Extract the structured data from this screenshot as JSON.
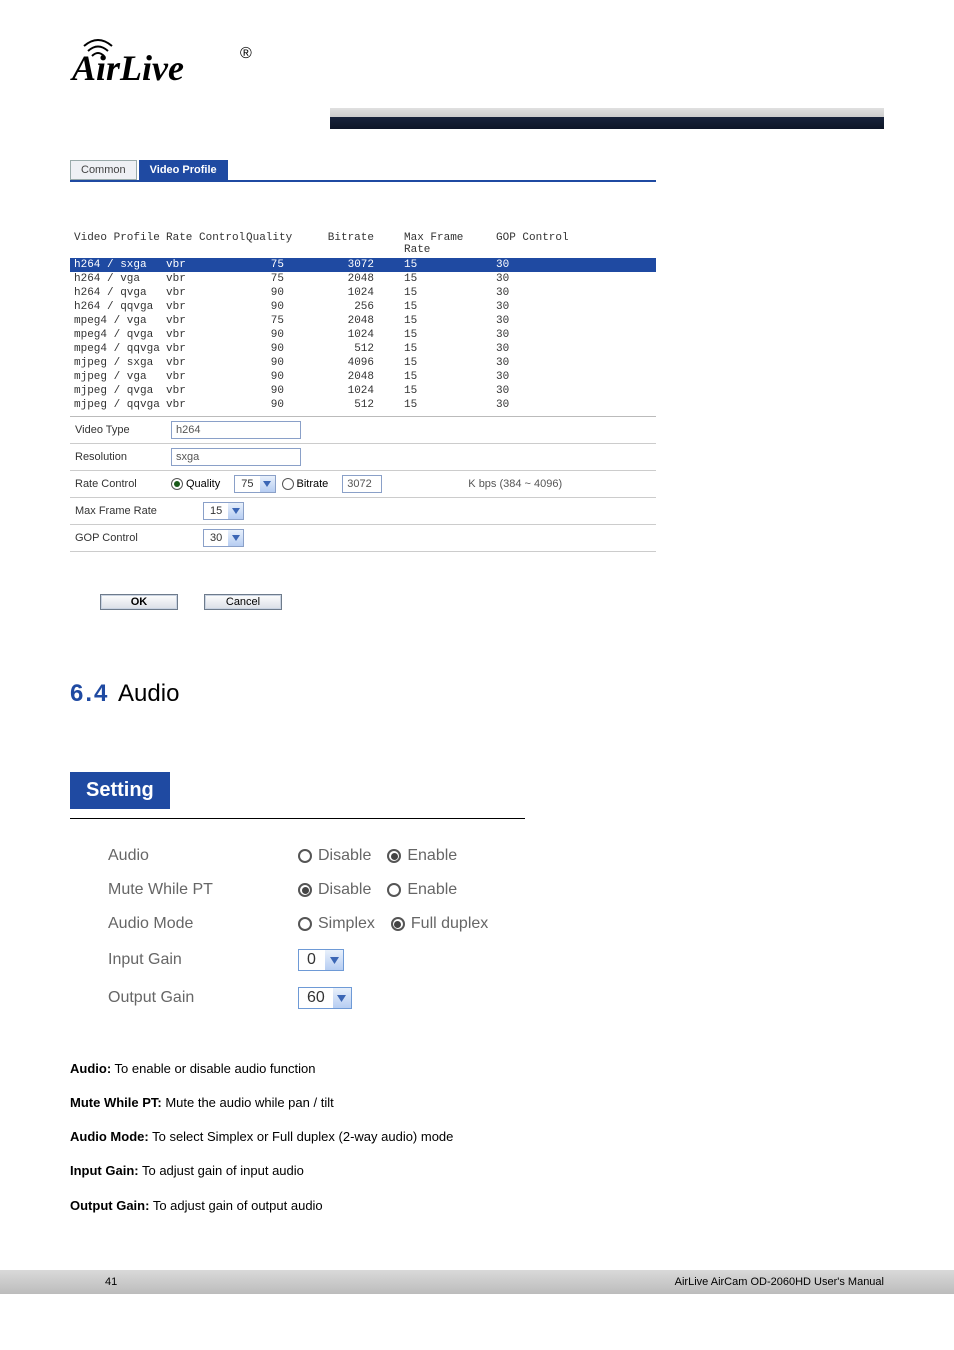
{
  "logo_text": "AirLive",
  "registered": "®",
  "tabs": {
    "common": "Common",
    "video": "Video Profile"
  },
  "cols": {
    "vp": "Video Profile",
    "rc": "Rate Control",
    "q": "Quality",
    "b": "Bitrate",
    "mf": "Max Frame Rate",
    "gop": "GOP Control"
  },
  "rows": [
    {
      "vp": "h264 / sxga",
      "rc": "vbr",
      "q": "75",
      "b": "3072",
      "mf": "15",
      "gop": "30",
      "sel": true
    },
    {
      "vp": "h264 / vga",
      "rc": "vbr",
      "q": "75",
      "b": "2048",
      "mf": "15",
      "gop": "30"
    },
    {
      "vp": "h264 / qvga",
      "rc": "vbr",
      "q": "90",
      "b": "1024",
      "mf": "15",
      "gop": "30"
    },
    {
      "vp": "h264 / qqvga",
      "rc": "vbr",
      "q": "90",
      "b": "256",
      "mf": "15",
      "gop": "30"
    },
    {
      "vp": "mpeg4 / vga",
      "rc": "vbr",
      "q": "75",
      "b": "2048",
      "mf": "15",
      "gop": "30"
    },
    {
      "vp": "mpeg4 / qvga",
      "rc": "vbr",
      "q": "90",
      "b": "1024",
      "mf": "15",
      "gop": "30"
    },
    {
      "vp": "mpeg4 / qqvga",
      "rc": "vbr",
      "q": "90",
      "b": "512",
      "mf": "15",
      "gop": "30"
    },
    {
      "vp": "mjpeg / sxga",
      "rc": "vbr",
      "q": "90",
      "b": "4096",
      "mf": "15",
      "gop": "30"
    },
    {
      "vp": "mjpeg / vga",
      "rc": "vbr",
      "q": "90",
      "b": "2048",
      "mf": "15",
      "gop": "30"
    },
    {
      "vp": "mjpeg / qvga",
      "rc": "vbr",
      "q": "90",
      "b": "1024",
      "mf": "15",
      "gop": "30"
    },
    {
      "vp": "mjpeg / qqvga",
      "rc": "vbr",
      "q": "90",
      "b": "512",
      "mf": "15",
      "gop": "30"
    }
  ],
  "form": {
    "vt_label": "Video Type",
    "vt_val": "h264",
    "res_label": "Resolution",
    "res_val": "sxga",
    "rc_label": "Rate Control",
    "quality_lbl": "Quality",
    "quality_val": "75",
    "bitrate_lbl": "Bitrate",
    "bitrate_val": "3072",
    "kbps": "K bps (384 ~ 4096)",
    "mf_label": "Max Frame Rate",
    "mf_val": "15",
    "gop_label": "GOP Control",
    "gop_val": "30"
  },
  "ok": "OK",
  "cancel": "Cancel",
  "s4": {
    "num": "6.4 ",
    "title": "Audio",
    "head": "Setting",
    "audio_lbl": "Audio",
    "disable": "Disable",
    "enable": "Enable",
    "mute_lbl": "Mute While PT",
    "mode_lbl": "Audio Mode",
    "simplex": "Simplex",
    "full": "Full duplex",
    "in_lbl": "Input Gain",
    "in_val": "0",
    "out_lbl": "Output Gain",
    "out_val": "60"
  },
  "para": {
    "t1": "Audio:",
    "p1": " To enable or disable audio function",
    "t2": "Mute While PT:",
    "p2": " Mute the audio while pan / tilt",
    "t3": "Audio Mode:",
    "p3": " To select Simplex or Full duplex (2-way audio) mode",
    "t4": "Input Gain:",
    "p4": " To adjust gain of input audio",
    "t5": "Output Gain:",
    "p5": " To adjust gain of output audio"
  },
  "footer_l": "41",
  "footer_r": "AirLive AirCam OD-2060HD User's Manual"
}
